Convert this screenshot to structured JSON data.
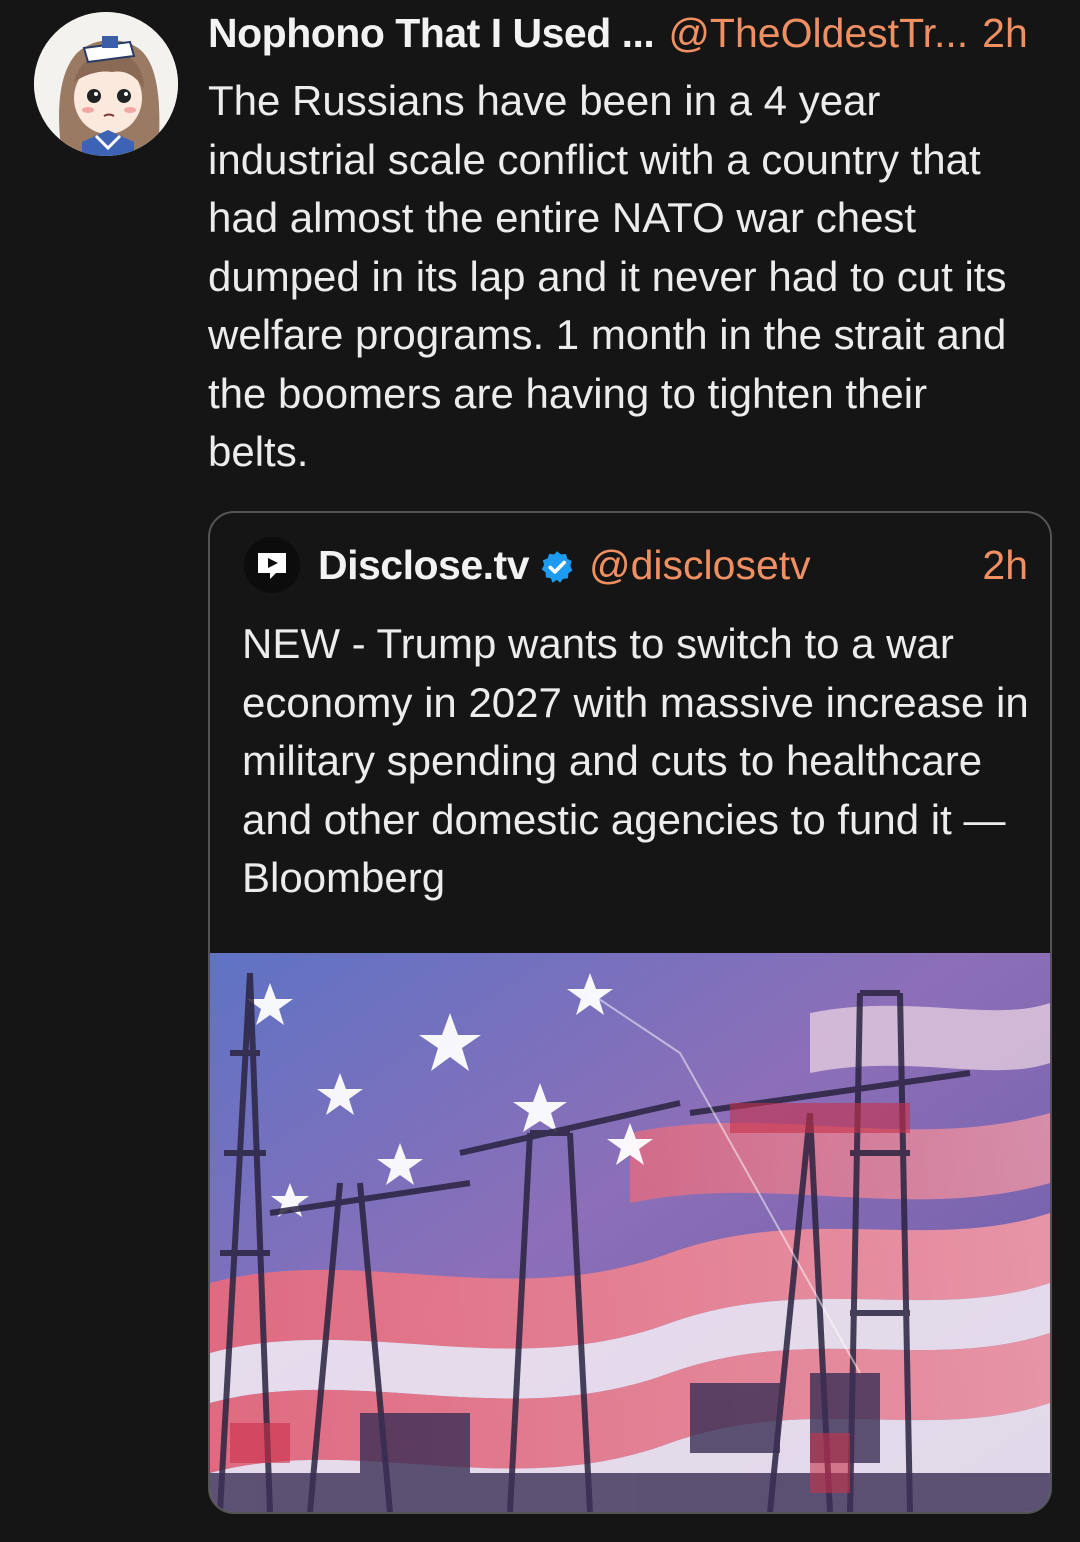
{
  "post": {
    "author_name": "Nophono That I Used ...",
    "author_handle": "@TheOldestTr...",
    "time": "2h",
    "text": "The Russians have been in a 4 year industrial scale conflict with a country that had almost the entire NATO war chest dumped in its lap and it never had to cut its welfare programs. 1 month in the strait and the boomers are having to tighten their belts."
  },
  "quote": {
    "author_name": "Disclose.tv",
    "author_handle": "@disclosetv",
    "time": "2h",
    "verified": true,
    "text": "NEW - Trump wants to switch to a war economy in 2027 with massive increase in military spending and cuts to healthcare and other domestic agencies to fund it — Bloomberg"
  },
  "colors": {
    "background": "#151515",
    "text": "#ececec",
    "handle_accent": "#ef8f62",
    "verified_blue": "#1d9bf0",
    "card_border": "#555555"
  },
  "icons": {
    "avatar": "anime-girl-avatar",
    "quote_avatar": "disclose-tv-logo-icon",
    "verified": "verified-badge-icon",
    "media": "american-flag-cranes-image"
  }
}
